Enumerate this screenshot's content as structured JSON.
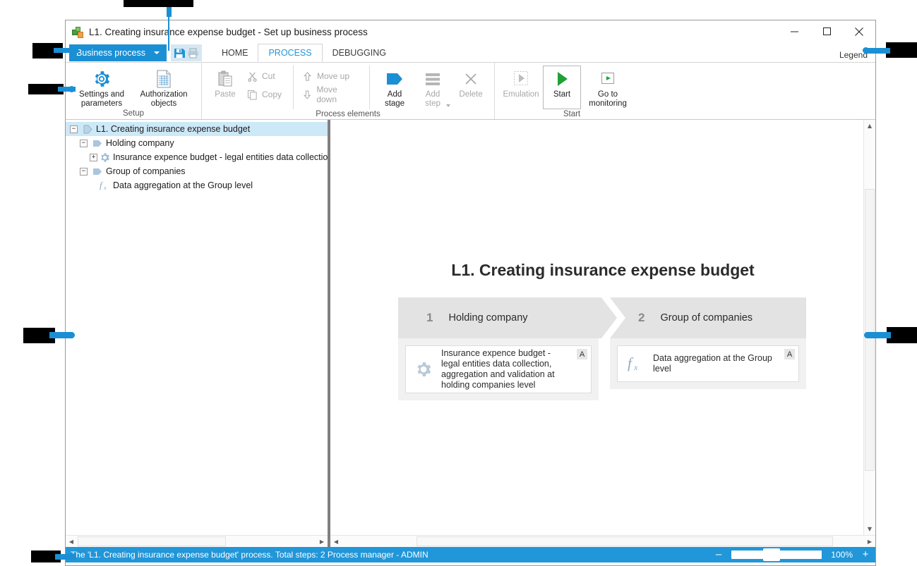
{
  "window": {
    "title": "L1. Creating insurance expense budget - Set up business process",
    "app_icon": "business-process-icon",
    "minimize": "minimize-icon",
    "maximize": "maximize-icon",
    "close": "close-icon"
  },
  "ribbon": {
    "business_process_button": "Business process",
    "quick_access": [
      "save-icon",
      "print-icon"
    ],
    "legend": "Legend",
    "tabs": [
      {
        "label": "HOME",
        "active": false
      },
      {
        "label": "PROCESS",
        "active": true
      },
      {
        "label": "DEBUGGING",
        "active": false
      }
    ],
    "groups": [
      {
        "title": "Setup",
        "buttons": [
          {
            "label": "Settings and parameters",
            "icon": "gear-icon",
            "disabled": false
          },
          {
            "label": "Authorization objects",
            "icon": "document-grid-icon",
            "disabled": false
          }
        ]
      },
      {
        "title": "Process elements",
        "buttons": [
          {
            "label": "Paste",
            "icon": "paste-icon",
            "disabled": true
          },
          {
            "label": "Cut",
            "icon": "scissors-icon",
            "disabled": true
          },
          {
            "label": "Copy",
            "icon": "copy-icon",
            "disabled": true
          },
          {
            "label": "Move up",
            "icon": "arrow-up-icon",
            "disabled": true
          },
          {
            "label": "Move down",
            "icon": "arrow-down-icon",
            "disabled": true
          },
          {
            "label": "Add stage",
            "icon": "stage-icon",
            "disabled": false
          },
          {
            "label": "Add step",
            "icon": "step-icon",
            "disabled": true
          },
          {
            "label": "Delete",
            "icon": "x-icon",
            "disabled": true
          }
        ]
      },
      {
        "title": "Start",
        "buttons": [
          {
            "label": "Emulation",
            "icon": "play-outline-icon",
            "disabled": true
          },
          {
            "label": "Start",
            "icon": "play-green-icon",
            "disabled": false
          },
          {
            "label": "Go to monitoring",
            "icon": "monitor-play-icon",
            "disabled": false
          }
        ]
      }
    ]
  },
  "tree": {
    "nodes": [
      {
        "label": "L1. Creating insurance expense budget",
        "indent": 0,
        "expander": "minus",
        "icon": "process-arrow-icon",
        "selected": true
      },
      {
        "label": "Holding company",
        "indent": 1,
        "expander": "minus",
        "icon": "stage-blue-icon",
        "selected": false
      },
      {
        "label": "Insurance expence budget - legal entities data collection, aggreg",
        "indent": 2,
        "expander": "plus",
        "icon": "gear-blue-icon",
        "selected": false
      },
      {
        "label": "Group of companies",
        "indent": 1,
        "expander": "minus",
        "icon": "stage-blue-icon",
        "selected": false
      },
      {
        "label": "Data aggregation at the Group level",
        "indent": 2,
        "expander": "none",
        "icon": "fx-icon",
        "selected": false
      }
    ]
  },
  "diagram": {
    "title": "L1. Creating insurance expense budget",
    "stages": [
      {
        "number": "1",
        "name": "Holding company",
        "steps": [
          {
            "text": "Insurance expence budget - legal entities data collection, aggregation and validation at holding companies level",
            "icon": "gear-icon",
            "badge": "A"
          }
        ]
      },
      {
        "number": "2",
        "name": "Group of companies",
        "steps": [
          {
            "text": "Data aggregation at the Group level",
            "icon": "fx-icon",
            "badge": "A"
          }
        ]
      }
    ]
  },
  "statusbar": {
    "text": "The 'L1. Creating insurance expense budget' process. Total steps: 2 Process manager - ADMIN",
    "zoom_out": "–",
    "zoom_in": "+",
    "zoom_level": "100%"
  },
  "colors": {
    "accent": "#1b8fd4",
    "status_bar": "#2196d8",
    "stage_header": "#e3e3e3",
    "stage_body": "#f1f1f1",
    "tree_selection": "#cde8f7",
    "annotation": "#000000"
  }
}
